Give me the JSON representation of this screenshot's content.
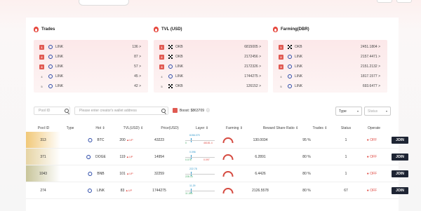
{
  "stats": [
    {
      "title": "Trades",
      "rows": [
        {
          "rank": "1",
          "name": "LINK",
          "value": "136 >"
        },
        {
          "rank": "2",
          "name": "LINK",
          "value": "87 >"
        },
        {
          "rank": "3",
          "name": "LINK",
          "value": "57 >"
        },
        {
          "rank": "4",
          "name": "LINK",
          "value": "45 >"
        },
        {
          "rank": "5",
          "name": "LINK",
          "value": "42 >"
        }
      ]
    },
    {
      "title": "TVL (USD)",
      "rows": [
        {
          "rank": "1",
          "name": "OKB",
          "value": "6815005 >"
        },
        {
          "rank": "2",
          "name": "OKB",
          "value": "2172456 >"
        },
        {
          "rank": "3",
          "name": "LINK",
          "value": "2172326 >"
        },
        {
          "rank": "4",
          "name": "LINK",
          "value": "1744275 >"
        },
        {
          "rank": "5",
          "name": "OKB",
          "value": "126152 >"
        }
      ]
    },
    {
      "title": "Farming(DBR)",
      "rows": [
        {
          "rank": "1",
          "name": "OKB",
          "value": "2451.1804 >"
        },
        {
          "rank": "2",
          "name": "LINK",
          "value": "2157.4471 >"
        },
        {
          "rank": "3",
          "name": "LINK",
          "value": "2151.2132 >"
        },
        {
          "rank": "4",
          "name": "LINK",
          "value": "1817.1577 >"
        },
        {
          "rank": "5",
          "name": "LINK",
          "value": "693.6477 >"
        }
      ]
    }
  ],
  "filters": {
    "pool_id_placeholder": "Pool ID",
    "creator_placeholder": "Please enter creator's wallet address",
    "boost": "Boost: $863709",
    "type_label": "Type",
    "status_label": "Status"
  },
  "columns": [
    "Pool ID",
    "Type",
    "Hot ⇕",
    "TVL(USD) ⇕",
    "Price(USD)",
    "Layer ⇕",
    "Farming ⇕",
    "Reward Share Ratio ⇕",
    "Trades ⇕",
    "Status",
    "Operate"
  ],
  "rows": [
    {
      "pool_id": "313",
      "type": "BTC",
      "hot": "200",
      "tvl": "43223",
      "price_top": "6156.079",
      "price_left": "0",
      "price_right": "46181.4",
      "layer": "0",
      "farming": "130.0034",
      "ratio": "95 %",
      "trades": "1",
      "status": "OFF",
      "op": "JOIN",
      "color": "#f1c878"
    },
    {
      "pool_id": "371",
      "type": "DOGE",
      "hot": "119",
      "tvl": "14954",
      "price_top": "0.096",
      "price_left": "0.076",
      "price_right": "0.097",
      "layer": "0",
      "farming": "6.2891",
      "ratio": "80 %",
      "trades": "1",
      "status": "OFF",
      "op": "JOIN",
      "color": "#e6d4a4"
    },
    {
      "pool_id": "1043",
      "type": "BNB",
      "hot": "101",
      "tvl": "32259",
      "price_top": "222.78",
      "price_left": "228.33",
      "price_right": "",
      "layer": "0",
      "farming": "6.4426",
      "ratio": "80 %",
      "trades": "1",
      "status": "OFF",
      "op": "JOIN",
      "color": "#c8c59a"
    },
    {
      "pool_id": "274",
      "type": "LINK",
      "hot": "83",
      "tvl": "1744275",
      "price_top": "11.29",
      "price_left": "11.286",
      "price_right": "",
      "layer": "2",
      "farming": "2126.5578",
      "ratio": "80 %",
      "trades": "67",
      "status": "OFF",
      "op": "JOIN",
      "color": "#ffffff"
    }
  ],
  "colors": {
    "accent": "#e05a52",
    "join_bg": "#1e2433"
  }
}
